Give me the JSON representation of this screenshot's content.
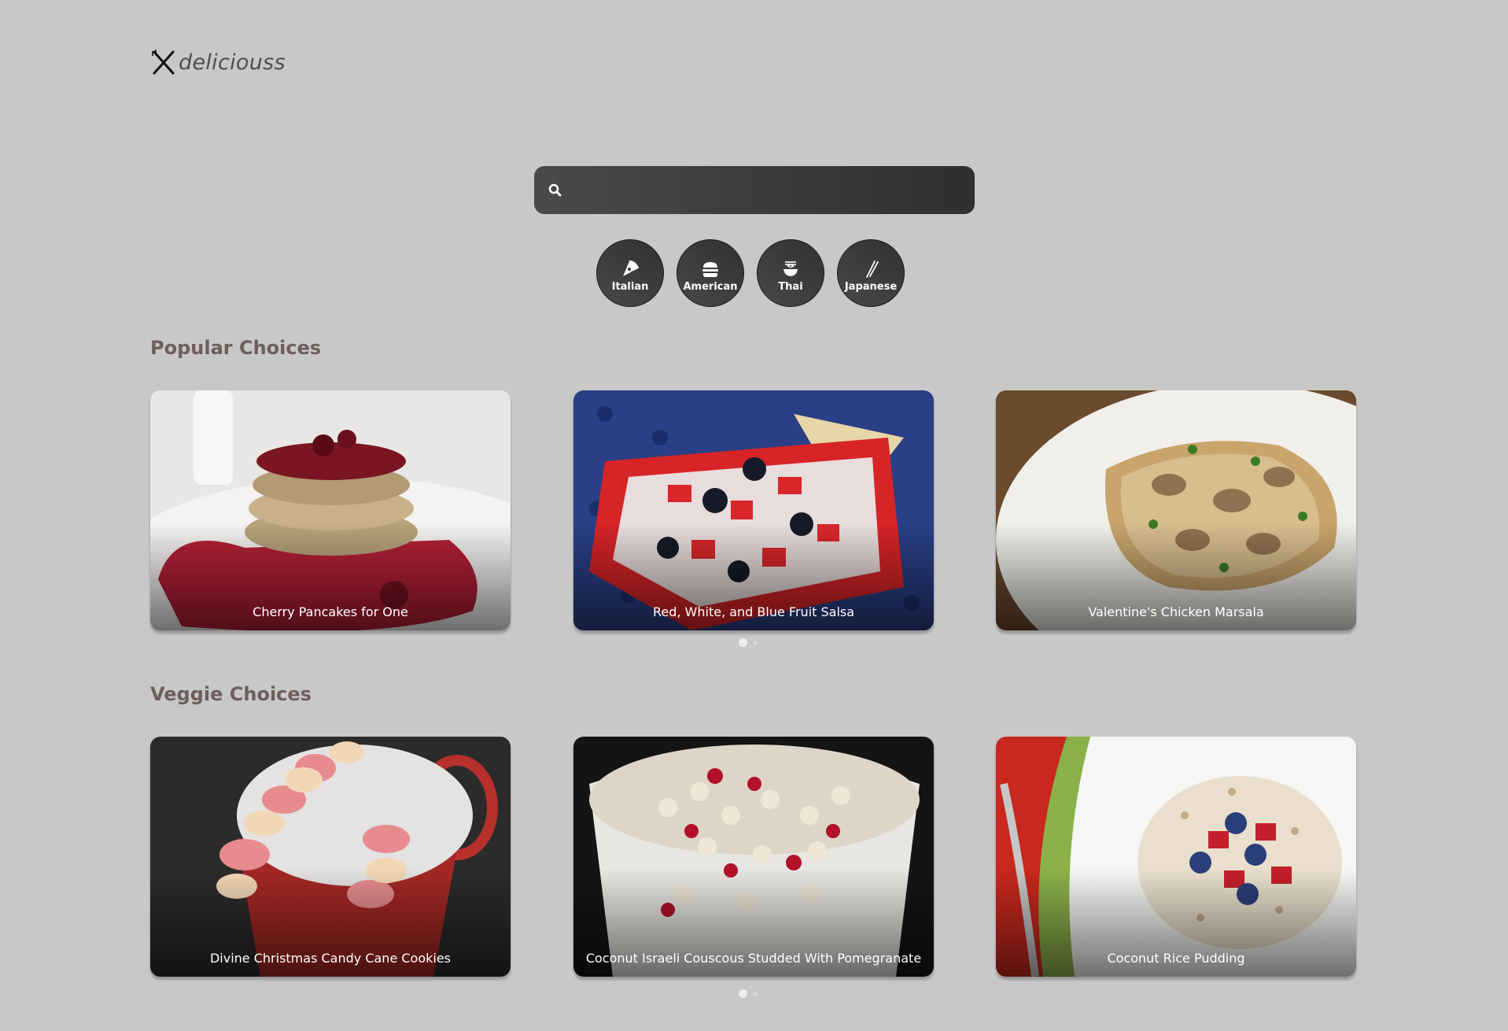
{
  "brand": {
    "name": "deliciouss",
    "icon": "fork-knife-icon"
  },
  "search": {
    "placeholder": "",
    "value": "",
    "icon": "search-icon"
  },
  "cuisines": [
    {
      "label": "Italian",
      "icon": "pizza-icon"
    },
    {
      "label": "American",
      "icon": "burger-icon"
    },
    {
      "label": "Thai",
      "icon": "noodles-icon"
    },
    {
      "label": "Japanese",
      "icon": "chopsticks-icon"
    }
  ],
  "popular": {
    "title": "Popular Choices",
    "cards": [
      {
        "title": "Cherry Pancakes for One"
      },
      {
        "title": "Red, White, and Blue Fruit Salsa"
      },
      {
        "title": "Valentine's Chicken Marsala"
      }
    ]
  },
  "veggie": {
    "title": "Veggie Choices",
    "cards": [
      {
        "title": "Divine Christmas Candy Cane Cookies"
      },
      {
        "title": "Coconut Israeli Couscous Studded With Pomegranate"
      },
      {
        "title": "Coconut Rice Pudding"
      }
    ]
  },
  "colors": {
    "background": "#c8c8c8",
    "button": "#3a3a3a",
    "heading": "#6e5e5e"
  }
}
